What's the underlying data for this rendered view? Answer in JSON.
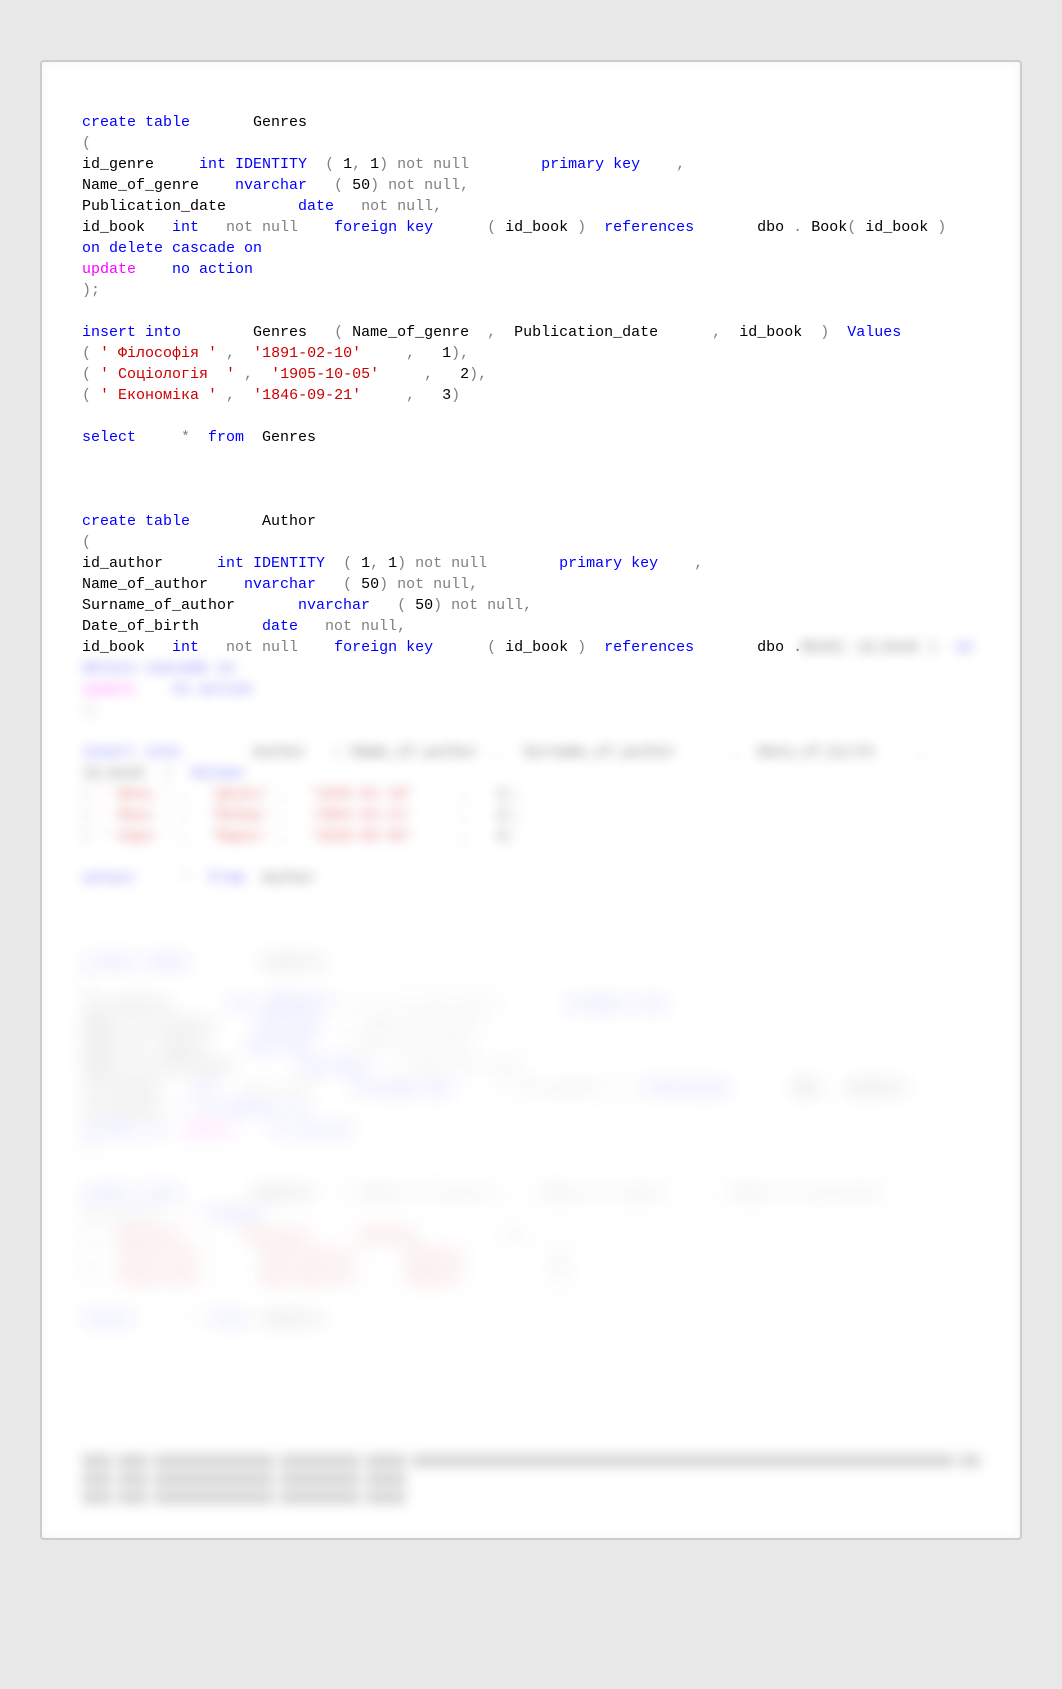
{
  "code": {
    "block1": {
      "line1_a": "create table",
      "line1_b": "       Genres",
      "line2": "(",
      "line3_a": "id_genre     ",
      "line3_b": "int IDENTITY",
      "line3_c": "  (",
      "line3_d": " 1",
      "line3_e": ", ",
      "line3_f": "1",
      "line3_g": ") not null        ",
      "line3_h": "primary key",
      "line3_i": "    ,",
      "line4_a": "Name_of_genre    ",
      "line4_b": "nvarchar",
      "line4_c": "   (",
      "line4_d": " 50",
      "line4_e": ") not null,",
      "line5_a": "Publication_date        ",
      "line5_b": "date",
      "line5_c": "   not null,",
      "line6_a": "id_book   ",
      "line6_b": "int",
      "line6_c": "   not null    ",
      "line6_d": "foreign key",
      "line6_e": "      (",
      "line6_f": " id_book ",
      "line6_g": ")  ",
      "line6_h": "references",
      "line6_i": "       dbo",
      "line6_j": " . ",
      "line6_k": "Book",
      "line6_l": "(",
      "line6_m": " id_book ",
      "line6_n": ")  ",
      "line6_o": "on delete cascade on",
      "line7_a": "update",
      "line7_b": "    ",
      "line7_c": "no action",
      "line8": ");"
    },
    "block2": {
      "line1_a": "insert into",
      "line1_b": "        Genres   ",
      "line1_c": "(",
      "line1_d": " Name_of_genre  ",
      "line1_e": ",",
      "line1_f": "  Publication_date      ",
      "line1_g": ",",
      "line1_h": "  id_book  ",
      "line1_i": ")  ",
      "line1_j": "Values",
      "line2_a": "(",
      "line2_b": " ' Філософія '",
      "line2_c": " ,  ",
      "line2_d": "'1891-02-10'",
      "line2_e": "     ,   ",
      "line2_f": "1",
      "line2_g": "),",
      "line3_a": "(",
      "line3_b": " ' Соціологія  '",
      "line3_c": " ,  ",
      "line3_d": "'1905-10-05'",
      "line3_e": "     ,   ",
      "line3_f": "2",
      "line3_g": "),",
      "line4_a": "(",
      "line4_b": " ' Економіка '",
      "line4_c": " ,  ",
      "line4_d": "'1846-09-21'",
      "line4_e": "     ,   ",
      "line4_f": "3",
      "line4_g": ")"
    },
    "block3": {
      "line1_a": "select",
      "line1_b": "     *  ",
      "line1_c": "from",
      "line1_d": "  Genres"
    },
    "block4": {
      "line1_a": "create table",
      "line1_b": "        Author",
      "line2": "(",
      "line3_a": "id_author      ",
      "line3_b": "int IDENTITY",
      "line3_c": "  (",
      "line3_d": " 1",
      "line3_e": ", ",
      "line3_f": "1",
      "line3_g": ") not null        ",
      "line3_h": "primary key",
      "line3_i": "    ,",
      "line4_a": "Name_of_author    ",
      "line4_b": "nvarchar",
      "line4_c": "   (",
      "line4_d": " 50",
      "line4_e": ") not null,",
      "line5_a": "Surname_of_author       ",
      "line5_b": "nvarchar",
      "line5_c": "   (",
      "line5_d": " 50",
      "line5_e": ") not null,",
      "line6_a": "Date_of_birth       ",
      "line6_b": "date",
      "line6_c": "   not null,",
      "line7_a": "id_book   ",
      "line7_b": "int",
      "line7_c": "   not null    ",
      "line7_d": "foreign key",
      "line7_e": "      (",
      "line7_f": " id_book ",
      "line7_g": ")  ",
      "line7_h": "references",
      "line7_i": "       dbo",
      "line7_j": " ."
    }
  }
}
